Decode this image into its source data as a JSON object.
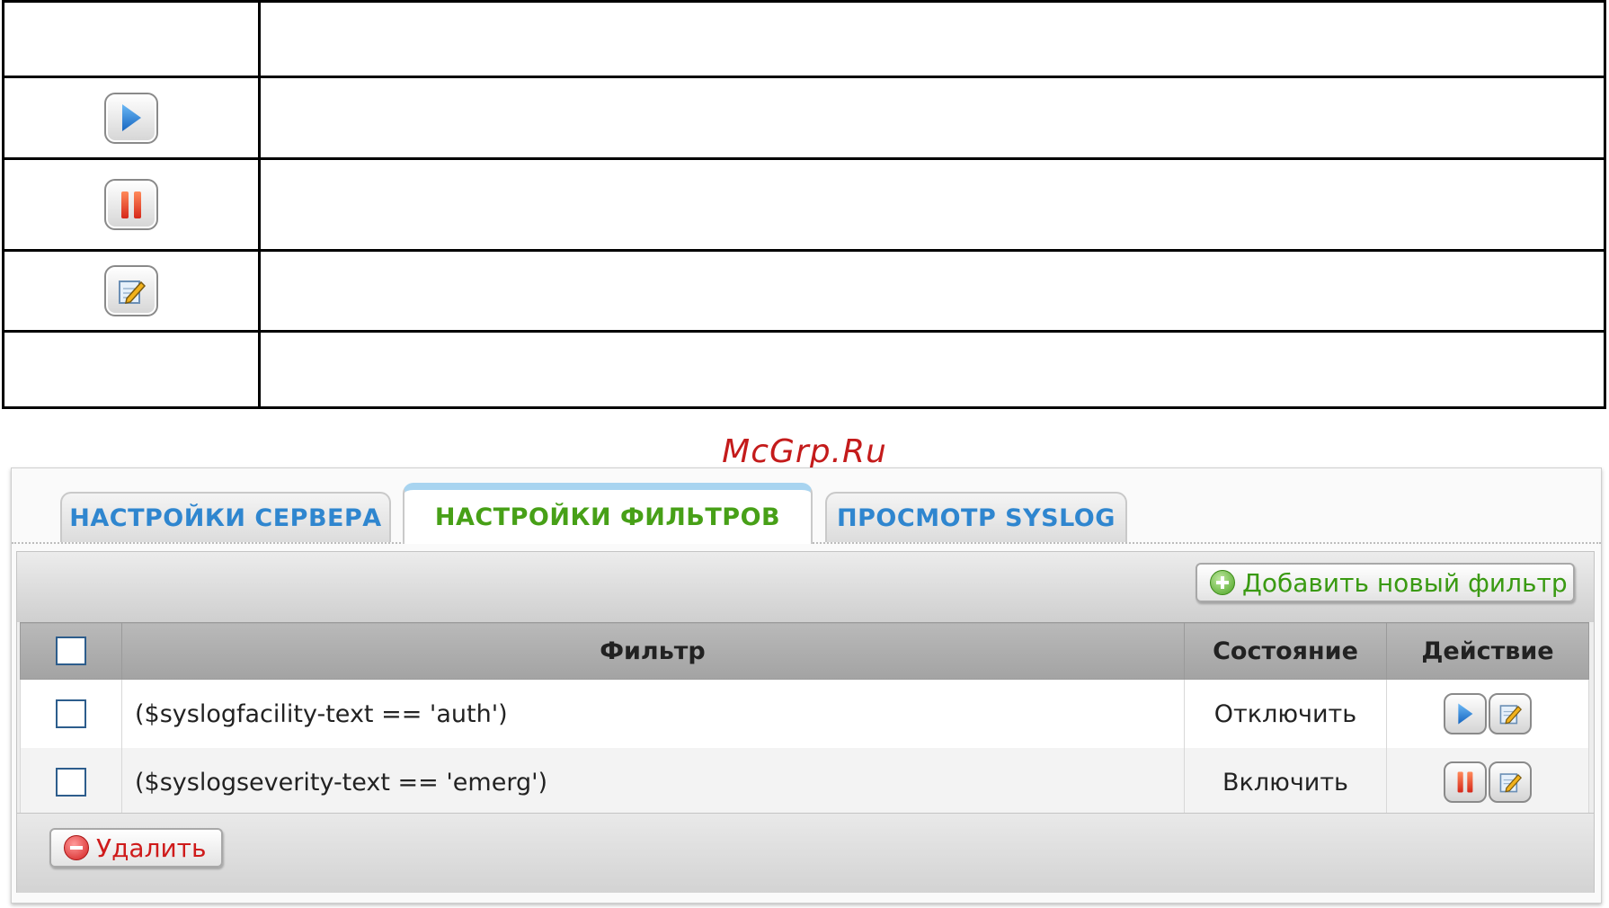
{
  "watermark": "McGrp.Ru",
  "legend": {
    "rows": [
      {
        "icon": ""
      },
      {
        "icon": "play-icon"
      },
      {
        "icon": "pause-icon"
      },
      {
        "icon": "edit-icon"
      },
      {
        "icon": ""
      }
    ]
  },
  "tabs": [
    {
      "label": "НАСТРОЙКИ СЕРВЕРА",
      "active": false
    },
    {
      "label": "НАСТРОЙКИ ФИЛЬТРОВ",
      "active": true
    },
    {
      "label": "ПРОСМОТР SYSLOG",
      "active": false
    }
  ],
  "toolbar": {
    "add_label": "Добавить новый фильтр",
    "delete_label": "Удалить"
  },
  "table": {
    "columns": [
      "",
      "Фильтр",
      "Состояние",
      "Действие"
    ],
    "rows": [
      {
        "filter": "($syslogfacility-text == 'auth')",
        "state": "Отключить",
        "actions": [
          "play-icon",
          "edit-icon"
        ]
      },
      {
        "filter": "($syslogseverity-text == 'emerg')",
        "state": "Включить",
        "actions": [
          "pause-icon",
          "edit-icon"
        ]
      }
    ]
  },
  "colors": {
    "tab_inactive": "#2f86cf",
    "tab_active": "#47a017",
    "add_button": "#3a9a12",
    "delete_button": "#cf1b1b",
    "watermark": "#c41b1b"
  }
}
